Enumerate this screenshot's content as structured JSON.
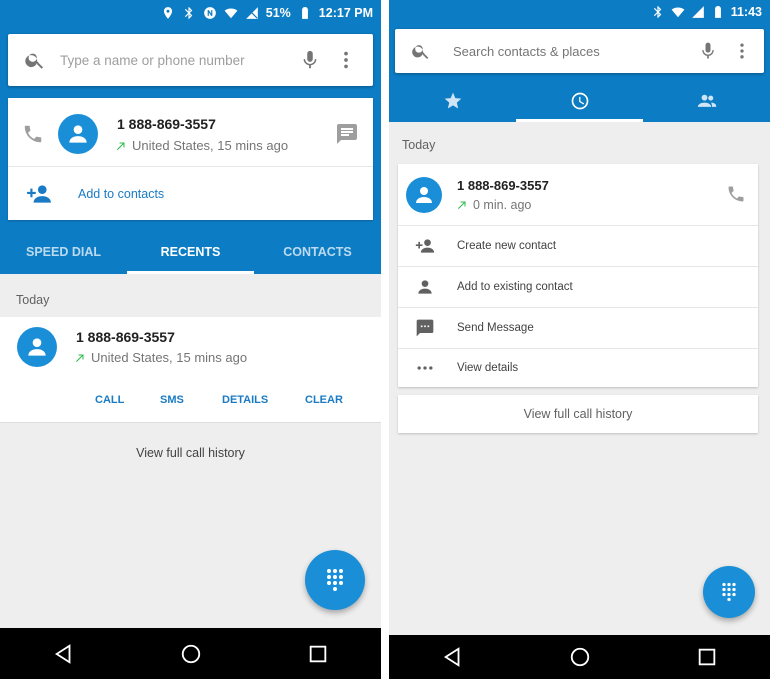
{
  "left": {
    "status": {
      "battery": "51%",
      "time": "12:17 PM"
    },
    "search": {
      "placeholder": "Type a name or phone number"
    },
    "call_card": {
      "number": "1 888-869-3557",
      "detail": "United States, 15 mins ago",
      "add_contact": "Add to contacts"
    },
    "tabs": [
      "SPEED DIAL",
      "RECENTS",
      "CONTACTS"
    ],
    "section": "Today",
    "recent": {
      "number": "1 888-869-3557",
      "detail": "United States, 15 mins ago",
      "actions": [
        "CALL",
        "SMS",
        "DETAILS",
        "CLEAR"
      ]
    },
    "history_link": "View full call history"
  },
  "right": {
    "status": {
      "time": "11:43"
    },
    "search": {
      "placeholder": "Search contacts & places"
    },
    "section": "Today",
    "recent": {
      "number": "1 888-869-3557",
      "detail": "0 min. ago"
    },
    "menu": [
      {
        "icon": "person-add-icon",
        "label": "Create new contact"
      },
      {
        "icon": "person-icon",
        "label": "Add to existing contact"
      },
      {
        "icon": "message-icon",
        "label": "Send Message"
      },
      {
        "icon": "more-horiz-icon",
        "label": "View details"
      }
    ],
    "history_link": "View full call history"
  },
  "colors": {
    "primary": "#0c7cc4",
    "accent": "#1a8fd8",
    "outgoing_arrow": "#2eb84b"
  }
}
